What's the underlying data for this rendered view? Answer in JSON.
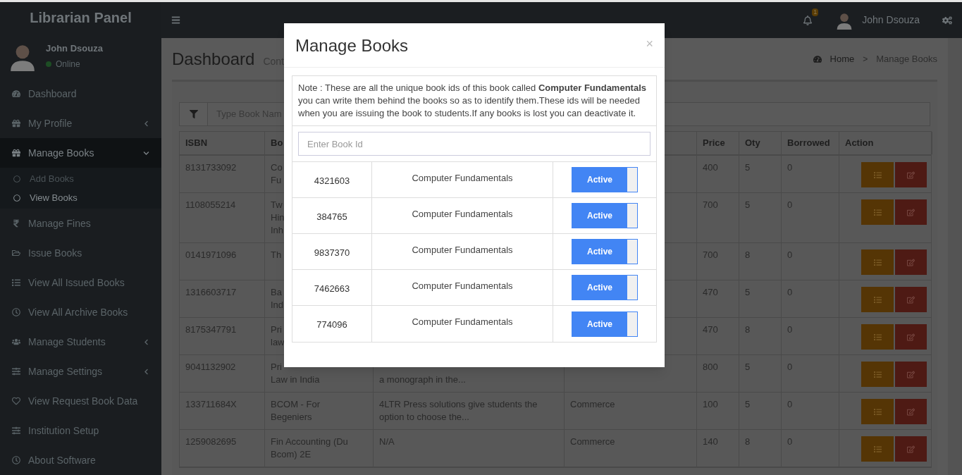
{
  "brand": "Librarian Panel",
  "user": {
    "name": "John Dsouza",
    "status": "Online",
    "online": true
  },
  "sidebar": {
    "items": [
      {
        "label": "Dashboard",
        "kind": "link"
      },
      {
        "label": "My Profile",
        "kind": "menu",
        "expanded": false
      },
      {
        "label": "Manage Books",
        "kind": "menu",
        "expanded": true,
        "children": [
          {
            "label": "Add Books",
            "selected": false
          },
          {
            "label": "View Books",
            "selected": true
          }
        ]
      },
      {
        "label": "Manage Fines",
        "kind": "link"
      },
      {
        "label": "Issue Books",
        "kind": "link"
      },
      {
        "label": "View All Issued Books",
        "kind": "link"
      },
      {
        "label": "View All Archive Books",
        "kind": "link"
      },
      {
        "label": "Manage Students",
        "kind": "menu",
        "expanded": false
      },
      {
        "label": "Manage Settings",
        "kind": "menu",
        "expanded": false
      },
      {
        "label": "View Request Book Data",
        "kind": "link"
      },
      {
        "label": "Institution Setup",
        "kind": "link"
      },
      {
        "label": "About Software",
        "kind": "link"
      }
    ]
  },
  "navbar": {
    "notifications": "1",
    "user_name": "John Dsouza"
  },
  "page": {
    "title": "Dashboard",
    "subtitle": "Cont",
    "breadcrumb": [
      "Home",
      "Manage Books"
    ],
    "breadcrumb_separator": ">"
  },
  "filter": {
    "placeholder": "Type Book Nam"
  },
  "table": {
    "columns": [
      "ISBN",
      "Bo",
      null,
      null,
      "Price",
      "Oty",
      "Borrowed",
      "Action"
    ],
    "rows": [
      {
        "isbn": "8131733092",
        "book": [
          "Co",
          "Fu"
        ],
        "price": "400",
        "qty": "5",
        "borrowed": "0"
      },
      {
        "isbn": "1108055214",
        "book": [
          "Tw",
          "Hin",
          "Inh"
        ],
        "price": "700",
        "qty": "5",
        "borrowed": "0"
      },
      {
        "isbn": "0141971096",
        "book": [
          "Th"
        ],
        "price": "700",
        "qty": "8",
        "borrowed": "0"
      },
      {
        "isbn": "1316603717",
        "book": [
          "Ba",
          "Ind"
        ],
        "price": "470",
        "qty": "5",
        "borrowed": "0"
      },
      {
        "isbn": "8175347791",
        "book": [
          "Pri",
          "law"
        ],
        "price": "470",
        "qty": "8",
        "borrowed": "0"
      },
      {
        "isbn": "9041132902",
        "book": [
          "Pri",
          "Law in India"
        ],
        "description": "a monograph in the...",
        "price": "800",
        "qty": "5",
        "borrowed": "0"
      },
      {
        "isbn": "133711684X",
        "book": [
          "BCOM - For",
          "Begeniers"
        ],
        "description": "4LTR Press solutions give students the option to choose the...",
        "category": "Commerce",
        "price": "100",
        "qty": "5",
        "borrowed": "0"
      },
      {
        "isbn": "1259082695",
        "book": [
          "Fin Accounting (Du",
          "Bcom) 2E"
        ],
        "description": "N/A",
        "category": "Commerce",
        "price": "140",
        "qty": "8",
        "borrowed": "0"
      }
    ]
  },
  "modal": {
    "title": "Manage Books",
    "close": "×",
    "note": "Note : These are all the unique book ids of this book called **Computer Fundamentals** you can write them behind the books so as to identify them.These ids will be needed when you are issuing the book to students.If any books is lost you can deactivate it.",
    "input_placeholder": "Enter Book Id",
    "rows": [
      {
        "id": "4321603",
        "name": "Computer Fundamentals",
        "label": "Active",
        "active": true
      },
      {
        "id": "384765",
        "name": "Computer Fundamentals",
        "label": "Active",
        "active": true
      },
      {
        "id": "9837370",
        "name": "Computer Fundamentals",
        "label": "Active",
        "active": true
      },
      {
        "id": "7462663",
        "name": "Computer Fundamentals",
        "label": "Active",
        "active": true
      },
      {
        "id": "774096",
        "name": "Computer Fundamentals",
        "label": "Active",
        "active": true
      }
    ]
  }
}
